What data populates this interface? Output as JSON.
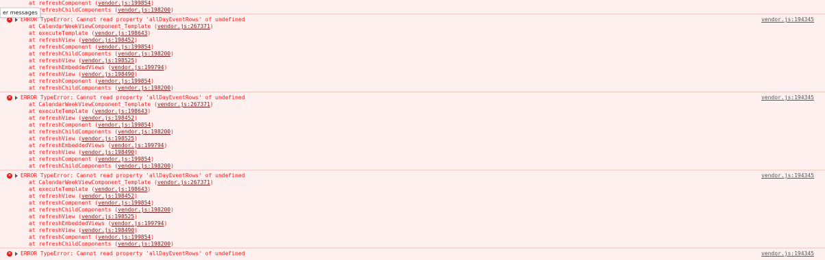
{
  "tooltip": "er messages",
  "partial_frames": [
    {
      "fn": "at refreshComponent",
      "link": "vendor.js:199854"
    },
    {
      "fn": "at refreshChildComponents",
      "link": "vendor.js:198200"
    }
  ],
  "messages": [
    {
      "text": "ERROR TypeError: Cannot read property 'allDayEventRows' of undefined",
      "source": "vendor.js:194345",
      "frames": [
        {
          "fn": "at CalendarWeekViewComponent_Template",
          "link": "vendor.js:267371"
        },
        {
          "fn": "at executeTemplate",
          "link": "vendor.js:198643"
        },
        {
          "fn": "at refreshView",
          "link": "vendor.js:198452"
        },
        {
          "fn": "at refreshComponent",
          "link": "vendor.js:199854"
        },
        {
          "fn": "at refreshChildComponents",
          "link": "vendor.js:198200"
        },
        {
          "fn": "at refreshView",
          "link": "vendor.js:198525"
        },
        {
          "fn": "at refreshEmbeddedViews",
          "link": "vendor.js:199794"
        },
        {
          "fn": "at refreshView",
          "link": "vendor.js:198490"
        },
        {
          "fn": "at refreshComponent",
          "link": "vendor.js:199854"
        },
        {
          "fn": "at refreshChildComponents",
          "link": "vendor.js:198200"
        }
      ]
    },
    {
      "text": "ERROR TypeError: Cannot read property 'allDayEventRows' of undefined",
      "source": "vendor.js:194345",
      "frames": [
        {
          "fn": "at CalendarWeekViewComponent_Template",
          "link": "vendor.js:267371"
        },
        {
          "fn": "at executeTemplate",
          "link": "vendor.js:198643"
        },
        {
          "fn": "at refreshView",
          "link": "vendor.js:198452"
        },
        {
          "fn": "at refreshComponent",
          "link": "vendor.js:199854"
        },
        {
          "fn": "at refreshChildComponents",
          "link": "vendor.js:198200"
        },
        {
          "fn": "at refreshView",
          "link": "vendor.js:198525"
        },
        {
          "fn": "at refreshEmbeddedViews",
          "link": "vendor.js:199794"
        },
        {
          "fn": "at refreshView",
          "link": "vendor.js:198490"
        },
        {
          "fn": "at refreshComponent",
          "link": "vendor.js:199854"
        },
        {
          "fn": "at refreshChildComponents",
          "link": "vendor.js:198200"
        }
      ]
    },
    {
      "text": "ERROR TypeError: Cannot read property 'allDayEventRows' of undefined",
      "source": "vendor.js:194345",
      "frames": [
        {
          "fn": "at CalendarWeekViewComponent_Template",
          "link": "vendor.js:267371"
        },
        {
          "fn": "at executeTemplate",
          "link": "vendor.js:198643"
        },
        {
          "fn": "at refreshView",
          "link": "vendor.js:198452"
        },
        {
          "fn": "at refreshComponent",
          "link": "vendor.js:199854"
        },
        {
          "fn": "at refreshChildComponents",
          "link": "vendor.js:198200"
        },
        {
          "fn": "at refreshView",
          "link": "vendor.js:198525"
        },
        {
          "fn": "at refreshEmbeddedViews",
          "link": "vendor.js:199794"
        },
        {
          "fn": "at refreshView",
          "link": "vendor.js:198490"
        },
        {
          "fn": "at refreshComponent",
          "link": "vendor.js:199854"
        },
        {
          "fn": "at refreshChildComponents",
          "link": "vendor.js:198200"
        }
      ]
    },
    {
      "text": "ERROR TypeError: Cannot read property 'allDayEventRows' of undefined",
      "source": "vendor.js:194345",
      "frames": []
    }
  ]
}
